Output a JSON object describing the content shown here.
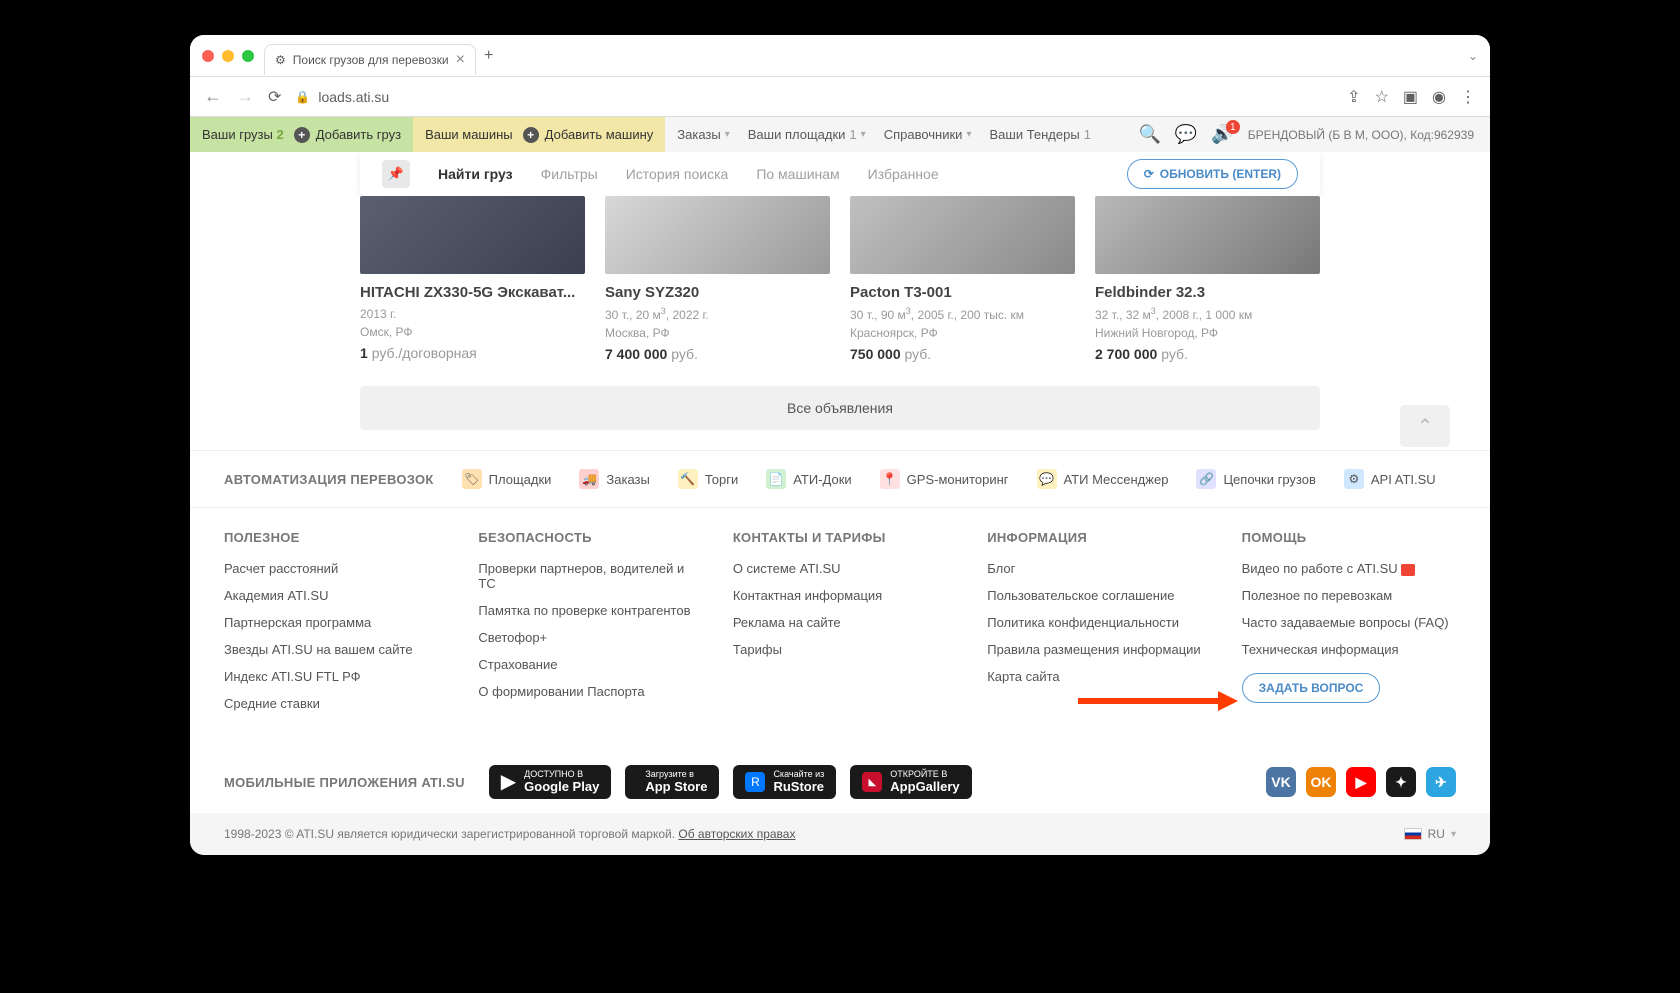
{
  "browser": {
    "tab_title": "Поиск грузов для перевозки",
    "url": "loads.ati.su"
  },
  "toolbar": {
    "your_loads": "Ваши грузы",
    "loads_count": "2",
    "add_load": "Добавить груз",
    "your_cars": "Ваши машины",
    "add_car": "Добавить машину",
    "orders": "Заказы",
    "your_platforms": "Ваши площадки",
    "platforms_count": "1",
    "guides": "Справочники",
    "your_tenders": "Ваши Тендеры",
    "tenders_count": "1",
    "brand": "БРЕНДОВЫЙ (Б В М, ООО),",
    "brand_code": "Код:962939"
  },
  "subbar": {
    "find": "Найти груз",
    "filters": "Фильтры",
    "history": "История поиска",
    "by_cars": "По машинам",
    "favorites": "Избранное",
    "refresh": "ОБНОВИТЬ (ENTER)"
  },
  "cards": [
    {
      "title": "HITACHI ZX330-5G Экскават...",
      "meta1": "2013 г.",
      "meta2": "Омск, РФ",
      "price_num": "1",
      "price_unit": "руб./договорная"
    },
    {
      "title": "Sany SYZ320",
      "meta1": "30 т., 20 м³, 2022 г.",
      "meta2": "Москва, РФ",
      "price_num": "7 400 000",
      "price_unit": "руб."
    },
    {
      "title": "Pacton T3-001",
      "meta1": "30 т., 90 м³, 2005 г., 200 тыс. км",
      "meta2": "Красноярск, РФ",
      "price_num": "750 000",
      "price_unit": "руб."
    },
    {
      "title": "Feldbinder 32.3",
      "meta1": "32 т., 32 м³, 2008 г., 1 000 км",
      "meta2": "Нижний Новгород, РФ",
      "price_num": "2 700 000",
      "price_unit": "руб."
    }
  ],
  "all_btn": "Все объявления",
  "auto": {
    "title": "АВТОМАТИЗАЦИЯ ПЕРЕВОЗОК",
    "items": [
      "Площадки",
      "Заказы",
      "Торги",
      "АТИ-Доки",
      "GPS-мониторинг",
      "АТИ Мессенджер",
      "Цепочки грузов",
      "API ATI.SU"
    ]
  },
  "footer": {
    "useful": {
      "title": "ПОЛЕЗНОЕ",
      "links": [
        "Расчет расстояний",
        "Академия ATI.SU",
        "Партнерская программа",
        "Звезды ATI.SU на вашем сайте",
        "Индекс ATI.SU FTL РФ",
        "Средние ставки"
      ]
    },
    "security": {
      "title": "БЕЗОПАСНОСТЬ",
      "links": [
        "Проверки партнеров, водителей и ТС",
        "Памятка по проверке контрагентов",
        "Светофор+",
        "Страхование",
        "О формировании Паспорта"
      ]
    },
    "contacts": {
      "title": "КОНТАКТЫ И ТАРИФЫ",
      "links": [
        "О системе ATI.SU",
        "Контактная информация",
        "Реклама на сайте",
        "Тарифы"
      ]
    },
    "info": {
      "title": "ИНФОРМАЦИЯ",
      "links": [
        "Блог",
        "Пользовательское соглашение",
        "Политика конфиденциальности",
        "Правила размещения информации",
        "Карта сайта"
      ]
    },
    "help": {
      "title": "ПОМОЩЬ",
      "links": [
        "Видео по работе с ATI.SU",
        "Полезное по перевозкам",
        "Часто задаваемые вопросы (FAQ)",
        "Техническая информация"
      ],
      "ask": "ЗАДАТЬ ВОПРОС"
    }
  },
  "apps": {
    "title": "МОБИЛЬНЫЕ ПРИЛОЖЕНИЯ ATI.SU",
    "google_top": "ДОСТУПНО В",
    "google": "Google Play",
    "app_top": "Загрузите в",
    "app": "App Store",
    "ru_top": "Скачайте из",
    "ru": "RuStore",
    "hw_top": "ОТКРОЙТЕ В",
    "hw": "AppGallery"
  },
  "bottom": {
    "copy": "1998-2023 © ATI.SU является юридически зарегистрированной торговой маркой. ",
    "link": "Об авторских правах",
    "lang": "RU"
  }
}
